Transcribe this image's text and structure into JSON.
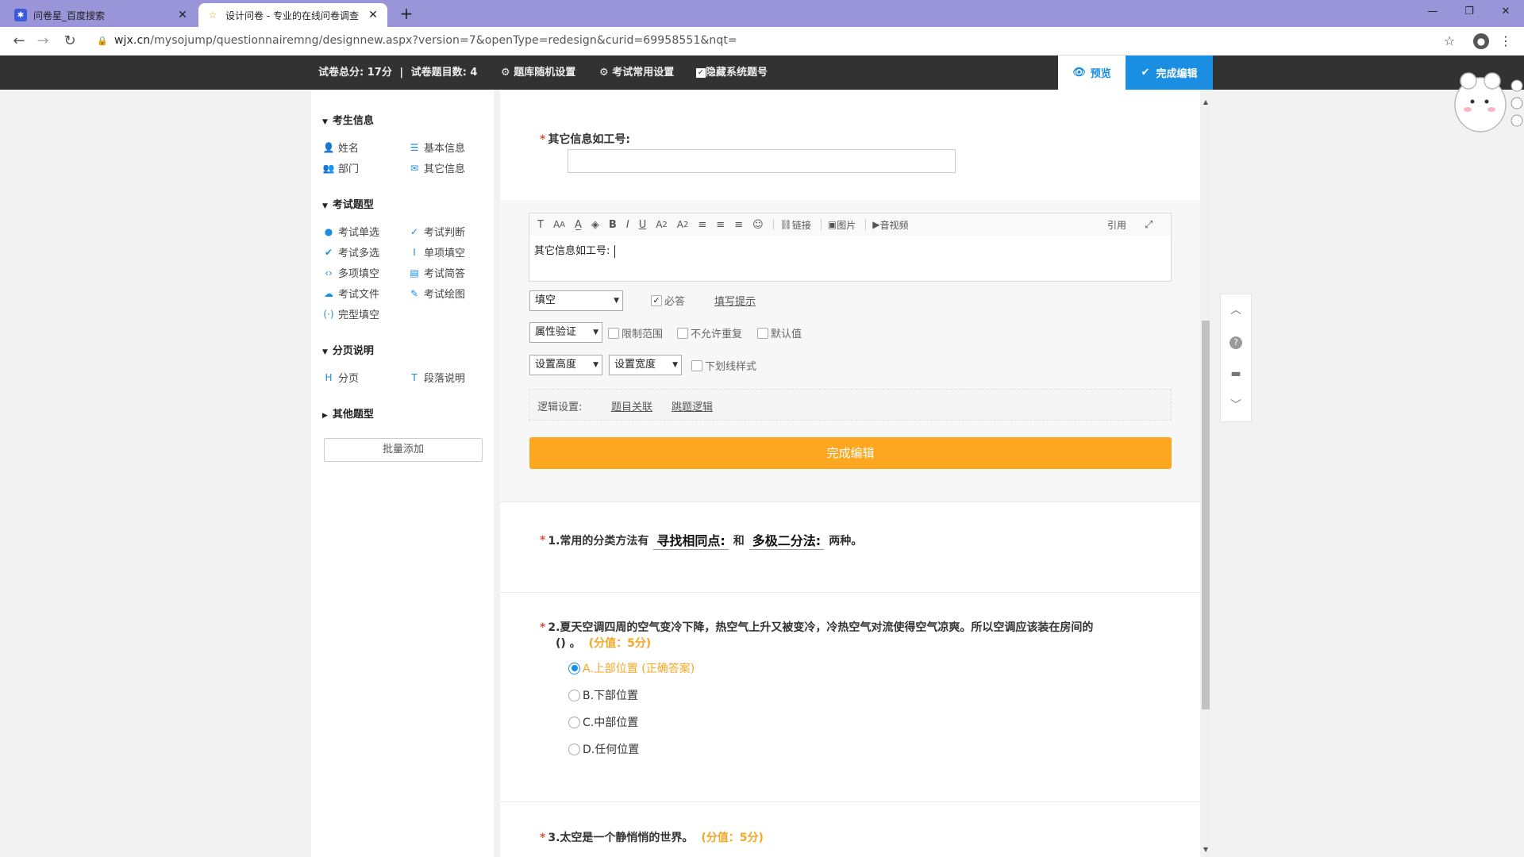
{
  "browser": {
    "tabs": [
      {
        "title": "问卷星_百度搜索",
        "active": false
      },
      {
        "title": "设计问卷 - 专业的在线问卷调查",
        "active": true
      }
    ],
    "new_tab": "+",
    "url_host": "wjx.cn",
    "url_path": "/mysojump/questionnairemng/designnew.aspx?version=7&openType=redesign&curid=69958551&nqt=",
    "window_controls": {
      "minimize": "—",
      "restore": "❐",
      "close": "✕"
    }
  },
  "topbar": {
    "total_score_label": "试卷总分:",
    "total_score": "17分",
    "separator": "|",
    "question_count_label": "试卷题目数:",
    "question_count": "4",
    "random_setting": "题库随机设置",
    "exam_setting": "考试常用设置",
    "hide_numbers": "隐藏系统题号",
    "preview": "预览",
    "finish": "完成编辑"
  },
  "sidebar": {
    "sections": [
      {
        "title": "考生信息",
        "items": [
          "姓名",
          "基本信息",
          "部门",
          "其它信息"
        ]
      },
      {
        "title": "考试题型",
        "items": [
          "考试单选",
          "考试判断",
          "考试多选",
          "单项填空",
          "多项填空",
          "考试简答",
          "考试文件",
          "考试绘图",
          "完型填空"
        ]
      },
      {
        "title": "分页说明",
        "items": [
          "分页",
          "段落说明"
        ]
      },
      {
        "title": "其他题型",
        "items": []
      }
    ],
    "batch_add": "批量添加"
  },
  "editor": {
    "question_title": "其它信息如工号:",
    "toolbar": {
      "link": "链接",
      "image": "图片",
      "media": "音视频",
      "quote": "引用"
    },
    "content": "其它信息如工号:",
    "type_select": "填空",
    "required_label": "必答",
    "hint_link": "填写提示",
    "validation_select": "属性验证",
    "limit_range": "限制范围",
    "no_repeat": "不允许重复",
    "default_value": "默认值",
    "height_select": "设置高度",
    "width_select": "设置宽度",
    "underline_style": "下划线样式",
    "logic_label": "逻辑设置:",
    "logic_link1": "题目关联",
    "logic_link2": "跳题逻辑",
    "finish_button": "完成编辑"
  },
  "questions": {
    "q1": {
      "prefix": "1.常用的分类方法有",
      "blank1": "寻找相同点:",
      "middle": "和",
      "blank2": "多极二分法:",
      "suffix": "两种。"
    },
    "q2": {
      "title_line1": "2.夏天空调四周的空气变冷下降，热空气上升又被变冷，冷热空气对流使得空气凉爽。所以空调应该装在房间的",
      "title_line2": "()  。",
      "score": "(分值：5分)",
      "options": [
        "A.上部位置 (正确答案)",
        "B.下部位置",
        "C.中部位置",
        "D.任何位置"
      ],
      "correct_index": 0
    },
    "q3": {
      "title": "3.太空是一个静悄悄的世界。",
      "score": "(分值：5分)"
    }
  }
}
